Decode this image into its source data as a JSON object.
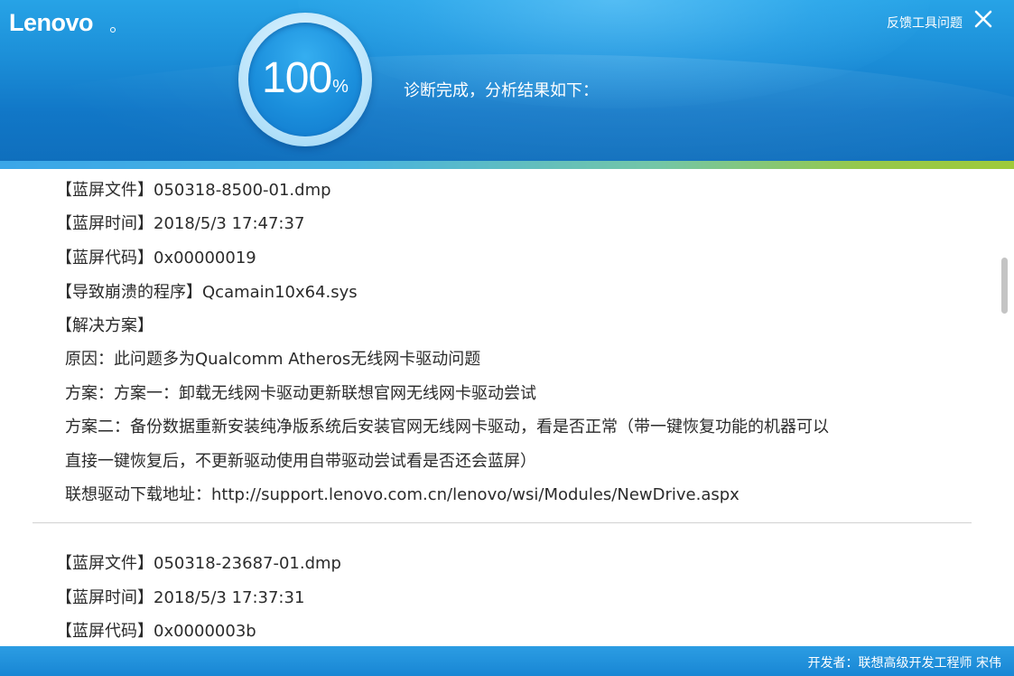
{
  "app": {
    "logo_text": "Lenovo",
    "feedback_label": "反馈工具问题",
    "close_icon": "close-icon"
  },
  "progress": {
    "value": "100",
    "unit": "%",
    "percent": 100,
    "status": "诊断完成，分析结果如下："
  },
  "report": {
    "entry1": {
      "file": "【蓝屏文件】050318-8500-01.dmp",
      "time": "【蓝屏时间】2018/5/3 17:47:37",
      "code": "【蓝屏代码】0x00000019",
      "program": "【导致崩溃的程序】Qcamain10x64.sys",
      "solution_header": "【解决方案】",
      "cause": "原因：此问题多为Qualcomm Atheros无线网卡驱动问题",
      "plan1": "方案：方案一：卸载无线网卡驱动更新联想官网无线网卡驱动尝试",
      "plan2_line1": "方案二：备份数据重新安装纯净版系统后安装官网无线网卡驱动，看是否正常（带一键恢复功能的机器可以",
      "plan2_line2": "直接一键恢复后，不更新驱动使用自带驱动尝试看是否还会蓝屏）",
      "download": "联想驱动下载地址：http://support.lenovo.com.cn/lenovo/wsi/Modules/NewDrive.aspx"
    },
    "entry2": {
      "file": "【蓝屏文件】050318-23687-01.dmp",
      "time": "【蓝屏时间】2018/5/3 17:37:31",
      "code": "【蓝屏代码】0x0000003b"
    }
  },
  "footer": {
    "developer": "开发者：联想高级开发工程师 宋伟"
  },
  "colors": {
    "header_blue": "#1c8fd8",
    "accent_green": "#9fca3a",
    "text_dark": "#2b2b2b"
  }
}
